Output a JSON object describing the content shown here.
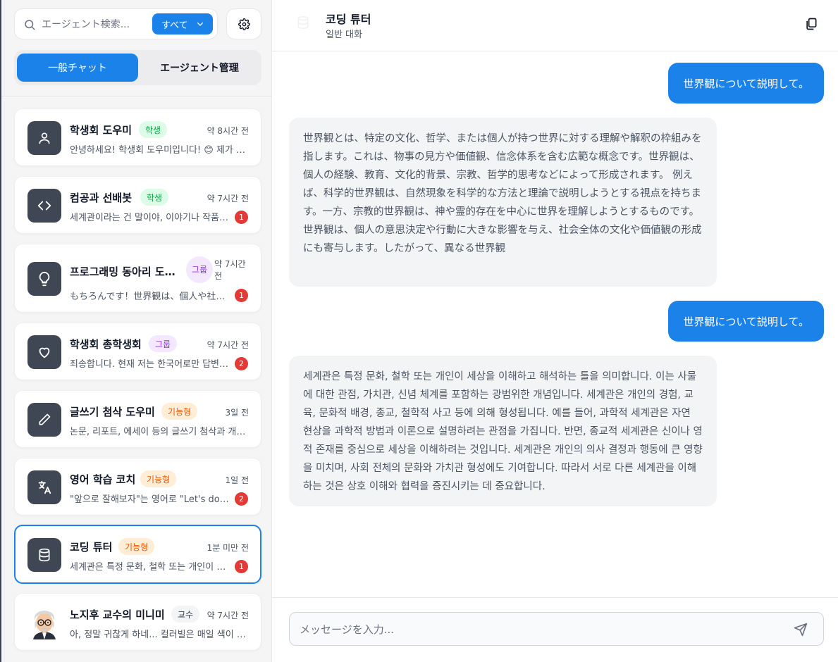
{
  "sidebar": {
    "search": {
      "placeholder": "エージェント検索..."
    },
    "filter": {
      "label": "すべて"
    },
    "tabs": [
      {
        "label": "一般チャット",
        "active": true
      },
      {
        "label": "エージェント管理",
        "active": false
      }
    ],
    "agents": [
      {
        "name": "학생회 도우미",
        "tag": "학생",
        "time": "약 8시간 전",
        "preview": "안녕하세요! 학생회 도우미입니다! 😊 제가 도와드릴게요",
        "badge": "",
        "icon": "user-icon"
      },
      {
        "name": "컴공과 선배봇",
        "tag": "학생",
        "time": "약 7시간 전",
        "preview": "세계관이라는 건 말이야, 이야기나 작품의 배경이 되는",
        "badge": "1",
        "icon": "code-icon"
      },
      {
        "name": "프로그래밍 동아리 도우미",
        "tag": "그룹",
        "time": "약 7시간 전",
        "preview": "もちろんです！世界観は、個人や社会が持つ",
        "badge": "1",
        "icon": "lightbulb-icon"
      },
      {
        "name": "학생회 총학생회",
        "tag": "그룹",
        "time": "약 7시간 전",
        "preview": "죄송합니다. 현재 저는 한국어로만 답변할 수 있습니다",
        "badge": "2",
        "icon": "heart-icon"
      },
      {
        "name": "글쓰기 첨삭 도우미",
        "tag": "기능형",
        "time": "3일 전",
        "preview": "논문, 리포트, 에세이 등의 글쓰기 첨삭과 개선을 도와드립니다",
        "badge": "",
        "icon": "pencil-icon"
      },
      {
        "name": "영어 학습 코치",
        "tag": "기능형",
        "time": "1일 전",
        "preview": "\"앞으로 잘해보자\"는 영어로 \"Let's do our best\"",
        "badge": "2",
        "icon": "translate-icon"
      },
      {
        "name": "코딩 튜터",
        "tag": "기능형",
        "time": "1분 미만 전",
        "preview": "세계관은 특정 문화, 철학 또는 개인이 세상을 이해하고",
        "badge": "1",
        "icon": "database-icon"
      },
      {
        "name": "노지후 교수의 미니미",
        "tag": "교수",
        "time": "약 7시간 전",
        "preview": "아, 정말 귀찮게 하네... 컬러빌은 매일 색이 바뀌어",
        "badge": "",
        "icon": "professor-avatar"
      }
    ]
  },
  "chat": {
    "title": "코딩 튜터",
    "subtitle": "일반 대화",
    "messages": [
      {
        "role": "user",
        "text": "世界観について説明して。"
      },
      {
        "role": "bot",
        "text": "世界観とは、特定の文化、哲学、または個人が持つ世界に対する理解や解釈の枠組みを指します。これは、物事の見方や価値観、信念体系を含む広範な概念です。世界観は、個人の経験、教育、文化的背景、宗教、哲学的思考などによって形成されます。 例えば、科学的世界観は、自然現象を科学的な方法と理論で説明しようとする視点を持ちます。一方、宗教的世界観は、神や霊的存在を中心に世界を理解しようとするものです。 世界観は、個人の意思決定や行動に大きな影響を与え、社会全体の文化や価値観の形成にも寄与します。したがって、異なる世界観"
      },
      {
        "role": "user",
        "text": "世界観について説明して。"
      },
      {
        "role": "bot",
        "text": "세계관은 특정 문화, 철학 또는 개인이 세상을 이해하고 해석하는 틀을 의미합니다. 이는 사물에 대한 관점, 가치관, 신념 체계를 포함하는 광범위한 개념입니다. 세계관은 개인의 경험, 교육, 문화적 배경, 종교, 철학적 사고 등에 의해 형성됩니다. 예를 들어, 과학적 세계관은 자연 현상을 과학적 방법과 이론으로 설명하려는 관점을 가집니다. 반면, 종교적 세계관은 신이나 영적 존재를 중심으로 세상을 이해하려는 것입니다. 세계관은 개인의 의사 결정과 행동에 큰 영향을 미치며, 사회 전체의 문화와 가치관 형성에도 기여합니다. 따라서 서로 다른 세계관을 이해하는 것은 상호 이해와 협력을 증진시키는 데 중요합니다."
      }
    ],
    "input": {
      "placeholder": "メッセージを入力..."
    }
  },
  "colors": {
    "accent": "#1a82e8",
    "badge": "#e53935",
    "avatar_bg": "#3f4654"
  }
}
